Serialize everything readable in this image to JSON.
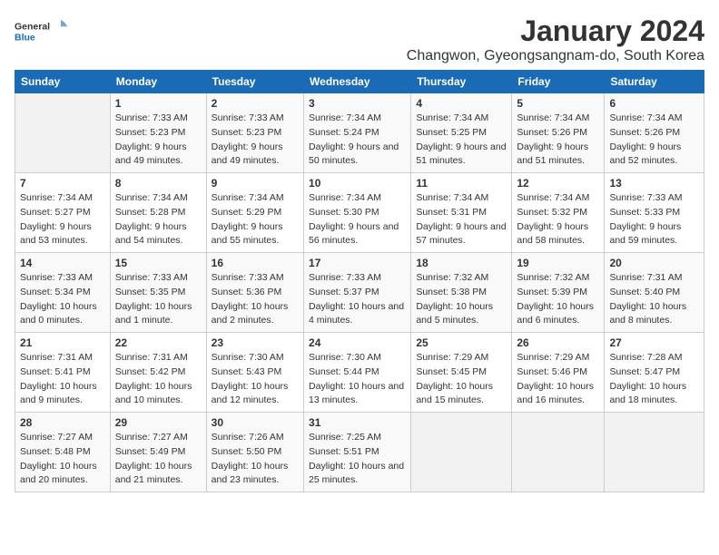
{
  "logo": {
    "line1": "General",
    "line2": "Blue"
  },
  "title": "January 2024",
  "subtitle": "Changwon, Gyeongsangnam-do, South Korea",
  "days_of_week": [
    "Sunday",
    "Monday",
    "Tuesday",
    "Wednesday",
    "Thursday",
    "Friday",
    "Saturday"
  ],
  "weeks": [
    [
      {
        "day": "",
        "sunrise": "",
        "sunset": "",
        "daylight": ""
      },
      {
        "day": "1",
        "sunrise": "7:33 AM",
        "sunset": "5:23 PM",
        "daylight": "9 hours and 49 minutes."
      },
      {
        "day": "2",
        "sunrise": "7:33 AM",
        "sunset": "5:23 PM",
        "daylight": "9 hours and 49 minutes."
      },
      {
        "day": "3",
        "sunrise": "7:34 AM",
        "sunset": "5:24 PM",
        "daylight": "9 hours and 50 minutes."
      },
      {
        "day": "4",
        "sunrise": "7:34 AM",
        "sunset": "5:25 PM",
        "daylight": "9 hours and 51 minutes."
      },
      {
        "day": "5",
        "sunrise": "7:34 AM",
        "sunset": "5:26 PM",
        "daylight": "9 hours and 51 minutes."
      },
      {
        "day": "6",
        "sunrise": "7:34 AM",
        "sunset": "5:26 PM",
        "daylight": "9 hours and 52 minutes."
      }
    ],
    [
      {
        "day": "7",
        "sunrise": "7:34 AM",
        "sunset": "5:27 PM",
        "daylight": "9 hours and 53 minutes."
      },
      {
        "day": "8",
        "sunrise": "7:34 AM",
        "sunset": "5:28 PM",
        "daylight": "9 hours and 54 minutes."
      },
      {
        "day": "9",
        "sunrise": "7:34 AM",
        "sunset": "5:29 PM",
        "daylight": "9 hours and 55 minutes."
      },
      {
        "day": "10",
        "sunrise": "7:34 AM",
        "sunset": "5:30 PM",
        "daylight": "9 hours and 56 minutes."
      },
      {
        "day": "11",
        "sunrise": "7:34 AM",
        "sunset": "5:31 PM",
        "daylight": "9 hours and 57 minutes."
      },
      {
        "day": "12",
        "sunrise": "7:34 AM",
        "sunset": "5:32 PM",
        "daylight": "9 hours and 58 minutes."
      },
      {
        "day": "13",
        "sunrise": "7:33 AM",
        "sunset": "5:33 PM",
        "daylight": "9 hours and 59 minutes."
      }
    ],
    [
      {
        "day": "14",
        "sunrise": "7:33 AM",
        "sunset": "5:34 PM",
        "daylight": "10 hours and 0 minutes."
      },
      {
        "day": "15",
        "sunrise": "7:33 AM",
        "sunset": "5:35 PM",
        "daylight": "10 hours and 1 minute."
      },
      {
        "day": "16",
        "sunrise": "7:33 AM",
        "sunset": "5:36 PM",
        "daylight": "10 hours and 2 minutes."
      },
      {
        "day": "17",
        "sunrise": "7:33 AM",
        "sunset": "5:37 PM",
        "daylight": "10 hours and 4 minutes."
      },
      {
        "day": "18",
        "sunrise": "7:32 AM",
        "sunset": "5:38 PM",
        "daylight": "10 hours and 5 minutes."
      },
      {
        "day": "19",
        "sunrise": "7:32 AM",
        "sunset": "5:39 PM",
        "daylight": "10 hours and 6 minutes."
      },
      {
        "day": "20",
        "sunrise": "7:31 AM",
        "sunset": "5:40 PM",
        "daylight": "10 hours and 8 minutes."
      }
    ],
    [
      {
        "day": "21",
        "sunrise": "7:31 AM",
        "sunset": "5:41 PM",
        "daylight": "10 hours and 9 minutes."
      },
      {
        "day": "22",
        "sunrise": "7:31 AM",
        "sunset": "5:42 PM",
        "daylight": "10 hours and 10 minutes."
      },
      {
        "day": "23",
        "sunrise": "7:30 AM",
        "sunset": "5:43 PM",
        "daylight": "10 hours and 12 minutes."
      },
      {
        "day": "24",
        "sunrise": "7:30 AM",
        "sunset": "5:44 PM",
        "daylight": "10 hours and 13 minutes."
      },
      {
        "day": "25",
        "sunrise": "7:29 AM",
        "sunset": "5:45 PM",
        "daylight": "10 hours and 15 minutes."
      },
      {
        "day": "26",
        "sunrise": "7:29 AM",
        "sunset": "5:46 PM",
        "daylight": "10 hours and 16 minutes."
      },
      {
        "day": "27",
        "sunrise": "7:28 AM",
        "sunset": "5:47 PM",
        "daylight": "10 hours and 18 minutes."
      }
    ],
    [
      {
        "day": "28",
        "sunrise": "7:27 AM",
        "sunset": "5:48 PM",
        "daylight": "10 hours and 20 minutes."
      },
      {
        "day": "29",
        "sunrise": "7:27 AM",
        "sunset": "5:49 PM",
        "daylight": "10 hours and 21 minutes."
      },
      {
        "day": "30",
        "sunrise": "7:26 AM",
        "sunset": "5:50 PM",
        "daylight": "10 hours and 23 minutes."
      },
      {
        "day": "31",
        "sunrise": "7:25 AM",
        "sunset": "5:51 PM",
        "daylight": "10 hours and 25 minutes."
      },
      {
        "day": "",
        "sunrise": "",
        "sunset": "",
        "daylight": ""
      },
      {
        "day": "",
        "sunrise": "",
        "sunset": "",
        "daylight": ""
      },
      {
        "day": "",
        "sunrise": "",
        "sunset": "",
        "daylight": ""
      }
    ]
  ]
}
